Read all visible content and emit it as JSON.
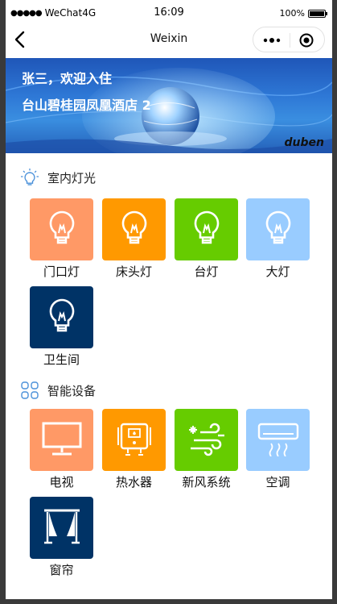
{
  "status_bar": {
    "carrier": "WeChat4G",
    "signal_dots": "●●●●●",
    "time": "16:09",
    "battery": "100%"
  },
  "nav": {
    "title": "Weixin"
  },
  "banner": {
    "greeting": "张三，欢迎入住",
    "hotel": "台山碧桂园凤凰酒店 2",
    "brand_logo": "duben"
  },
  "sections": {
    "lights": {
      "title": "室内灯光",
      "items": [
        {
          "label": "门口灯",
          "color": "#ff9966",
          "icon": "bulb-icon"
        },
        {
          "label": "床头灯",
          "color": "#ff9900",
          "icon": "bulb-icon"
        },
        {
          "label": "台灯",
          "color": "#66cc00",
          "icon": "bulb-icon"
        },
        {
          "label": "大灯",
          "color": "#99ccff",
          "icon": "bulb-icon"
        },
        {
          "label": "卫生间",
          "color": "#003366",
          "icon": "bulb-icon"
        }
      ]
    },
    "devices": {
      "title": "智能设备",
      "items": [
        {
          "label": "电视",
          "color": "#ff9966",
          "icon": "tv-icon"
        },
        {
          "label": "热水器",
          "color": "#ff9900",
          "icon": "water-heater-icon"
        },
        {
          "label": "新风系统",
          "color": "#66cc00",
          "icon": "fresh-air-icon"
        },
        {
          "label": "空调",
          "color": "#99ccff",
          "icon": "air-conditioner-icon"
        },
        {
          "label": "窗帘",
          "color": "#003366",
          "icon": "curtain-icon"
        }
      ]
    }
  }
}
